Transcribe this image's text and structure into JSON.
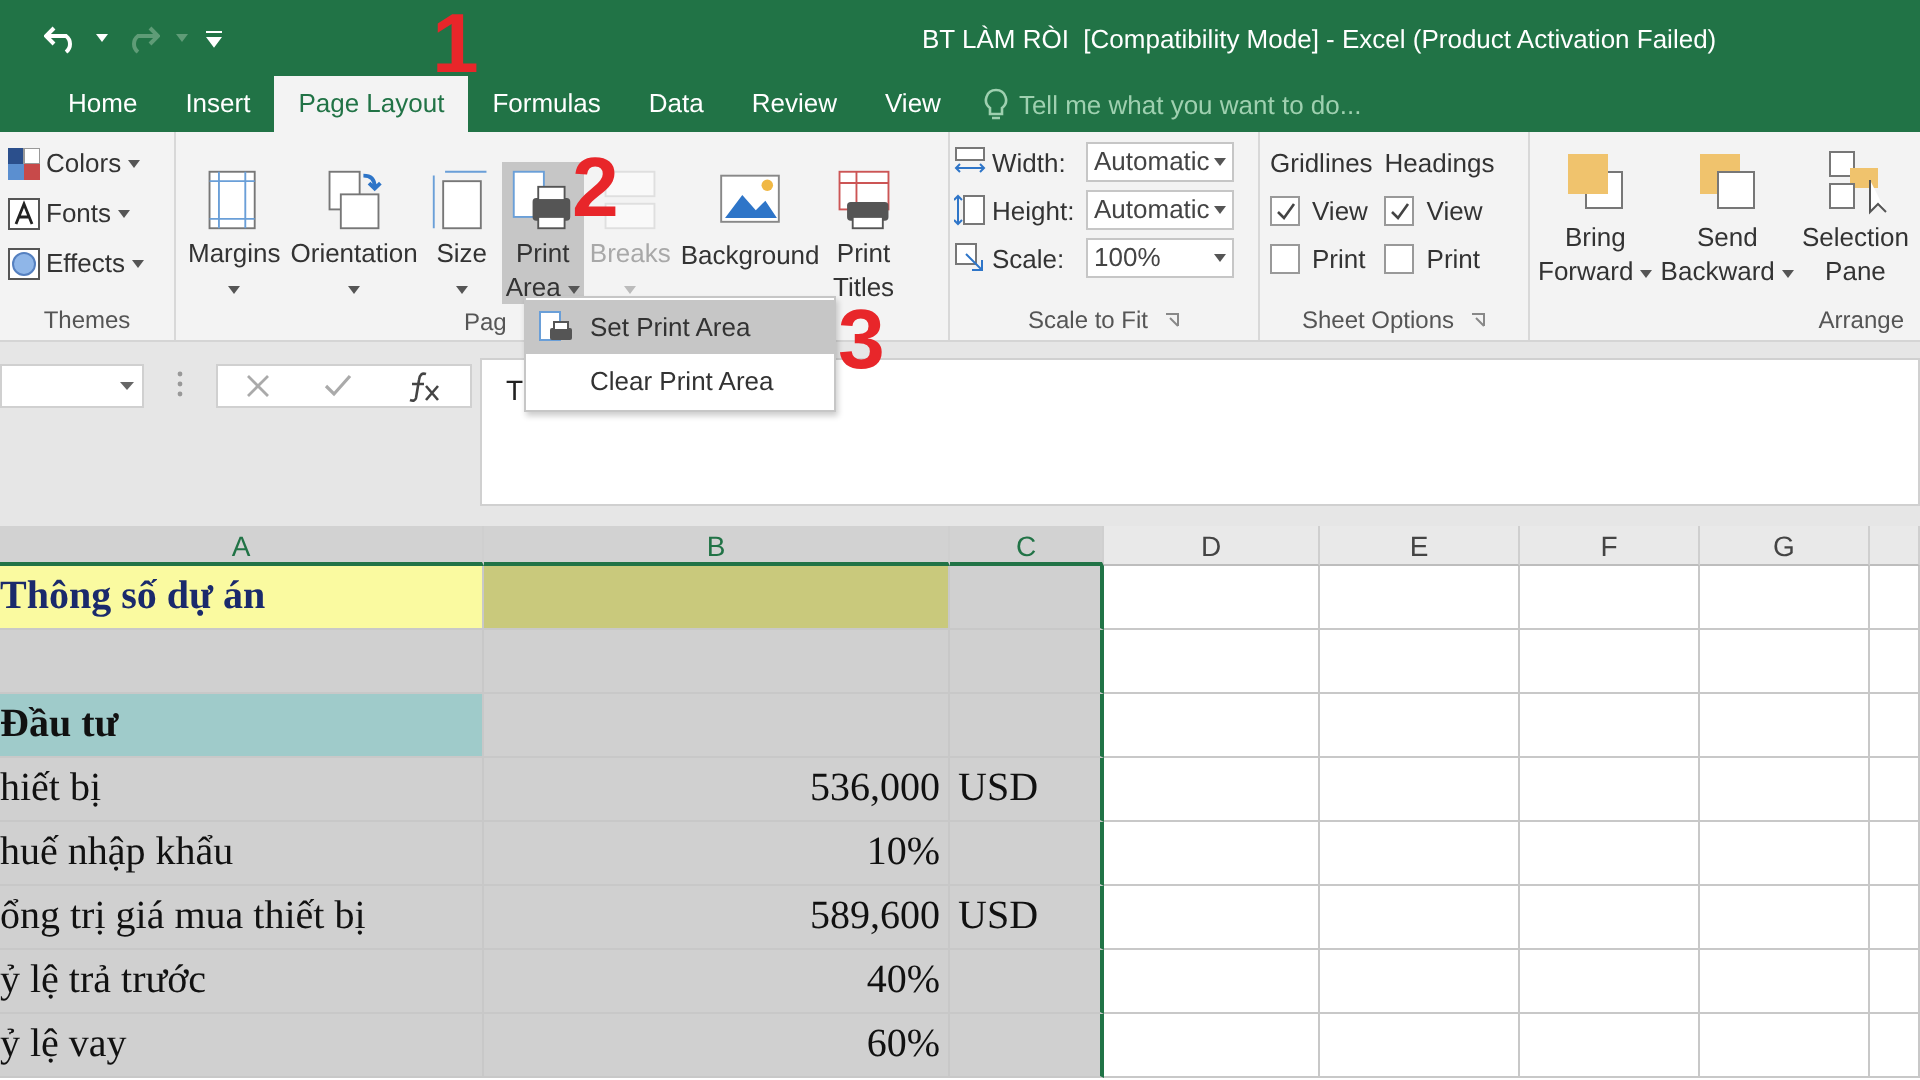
{
  "window": {
    "title": "BT LÀM RÒI  [Compatibility Mode] - Excel (Product Activation Failed)"
  },
  "quick_access": [
    {
      "kind": "undo",
      "disabled": false
    },
    {
      "kind": "redo",
      "disabled": true
    },
    {
      "kind": "customize",
      "disabled": false
    }
  ],
  "tabs": [
    {
      "label": "Home",
      "selected": false
    },
    {
      "label": "Insert",
      "selected": false
    },
    {
      "label": "Page Layout",
      "selected": true
    },
    {
      "label": "Formulas",
      "selected": false
    },
    {
      "label": "Data",
      "selected": false
    },
    {
      "label": "Review",
      "selected": false
    },
    {
      "label": "View",
      "selected": false
    }
  ],
  "tell_me": {
    "placeholder": "Tell me what you want to do..."
  },
  "ribbon": {
    "themes": {
      "label": "Themes",
      "items": [
        {
          "kind": "colors",
          "label": "Colors"
        },
        {
          "kind": "fonts",
          "label": "Fonts"
        },
        {
          "kind": "effects",
          "label": "Effects"
        }
      ]
    },
    "page_setup": {
      "label": "Pag",
      "buttons": [
        {
          "kind": "margins",
          "label": "Margins",
          "pressed": false,
          "disabled": false
        },
        {
          "kind": "orientation",
          "label": "Orientation",
          "pressed": false,
          "disabled": false
        },
        {
          "kind": "size",
          "label": "Size",
          "pressed": false,
          "disabled": false
        },
        {
          "kind": "print_area",
          "label": "Print Area",
          "pressed": true,
          "disabled": false
        },
        {
          "kind": "breaks",
          "label": "Breaks",
          "pressed": false,
          "disabled": true
        },
        {
          "kind": "background",
          "label": "Background",
          "pressed": false,
          "disabled": false
        },
        {
          "kind": "print_titles",
          "label": "Print Titles",
          "pressed": false,
          "disabled": false
        }
      ]
    },
    "scale_to_fit": {
      "label": "Scale to Fit",
      "fields": [
        {
          "kind": "width",
          "label": "Width:",
          "value": "Automatic"
        },
        {
          "kind": "height",
          "label": "Height:",
          "value": "Automatic"
        },
        {
          "kind": "scale",
          "label": "Scale:",
          "value": "100%"
        }
      ]
    },
    "sheet_options": {
      "label": "Sheet Options",
      "columns": [
        {
          "heading": "Gridlines",
          "options": [
            {
              "label": "View",
              "checked": true
            },
            {
              "label": "Print",
              "checked": false
            }
          ]
        },
        {
          "heading": "Headings",
          "options": [
            {
              "label": "View",
              "checked": true
            },
            {
              "label": "Print",
              "checked": false
            }
          ]
        }
      ]
    },
    "arrange": {
      "label": "Arrange",
      "buttons": [
        {
          "kind": "bring_forward",
          "label": "Bring Forward"
        },
        {
          "kind": "send_backward",
          "label": "Send Backward"
        },
        {
          "kind": "selection_pane",
          "label": "Selection Pane"
        }
      ]
    }
  },
  "print_area_menu": [
    {
      "label": "Set Print Area",
      "selected": true
    },
    {
      "label": "Clear Print Area",
      "selected": false
    }
  ],
  "formula_bar": {
    "value": "T"
  },
  "sheet": {
    "columns": [
      "A",
      "B",
      "C",
      "D",
      "E",
      "F",
      "G"
    ],
    "rows": [
      {
        "kind": "title",
        "cells": [
          "Thông số dự án",
          "",
          ""
        ]
      },
      {
        "kind": "blank",
        "cells": [
          "",
          "",
          ""
        ]
      },
      {
        "kind": "section",
        "cells": [
          "Đầu tư",
          "",
          ""
        ]
      },
      {
        "kind": "item",
        "cells": [
          "hiết bị",
          "536,000",
          "USD"
        ]
      },
      {
        "kind": "item",
        "cells": [
          "huế nhập khẩu",
          "10%",
          ""
        ]
      },
      {
        "kind": "item",
        "cells": [
          "ổng trị giá mua thiết bị",
          "589,600",
          "USD"
        ]
      },
      {
        "kind": "item",
        "cells": [
          "ỷ lệ trả trước",
          "40%",
          ""
        ]
      },
      {
        "kind": "item",
        "cells": [
          "ỷ lệ vay",
          "60%",
          ""
        ]
      }
    ]
  },
  "annotations": [
    "1",
    "2",
    "3"
  ]
}
